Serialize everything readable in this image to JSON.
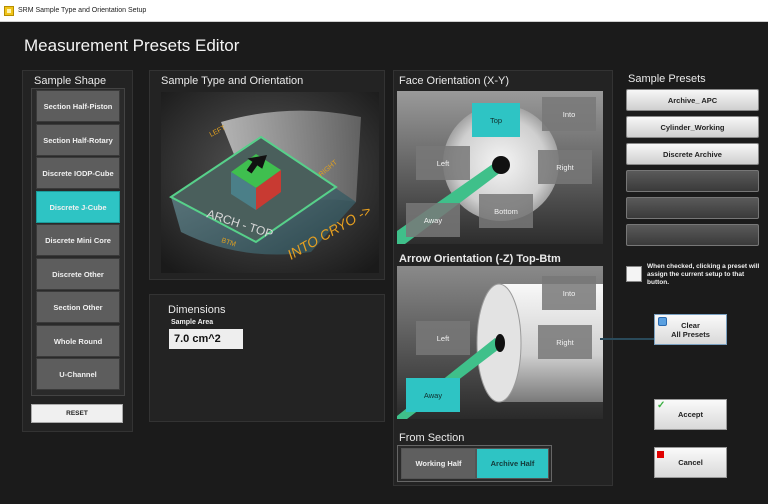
{
  "window": {
    "title": "SRM Sample Type and Orientation Setup"
  },
  "page": {
    "title": "Measurement Presets Editor"
  },
  "sample_shape": {
    "title": "Sample Shape",
    "items": [
      {
        "label": "Section Half-Piston",
        "active": false
      },
      {
        "label": "Section Half-Rotary",
        "active": false
      },
      {
        "label": "Discrete IODP-Cube",
        "active": false
      },
      {
        "label": "Discrete J-Cube",
        "active": true
      },
      {
        "label": "Discrete Mini Core",
        "active": false
      },
      {
        "label": "Discrete Other",
        "active": false
      },
      {
        "label": "Section Other",
        "active": false
      },
      {
        "label": "Whole Round",
        "active": false
      },
      {
        "label": "U-Channel",
        "active": false
      }
    ],
    "reset_label": "RESET"
  },
  "sample_type": {
    "title": "Sample Type and Orientation",
    "image_labels": {
      "left": "LEFT",
      "right": "RIGHT",
      "top": "ARCH - TOP",
      "bottom": "BTM",
      "cryo": "INTO CRYO ->"
    }
  },
  "dimensions": {
    "title": "Dimensions",
    "area_label": "Sample Area",
    "area_value": "7.0 cm^2"
  },
  "face_orientation": {
    "title": "Face Orientation (X-Y)",
    "labels": {
      "top": "Top",
      "into": "Into",
      "left": "Left",
      "right": "Right",
      "away": "Away",
      "bottom": "Bottom"
    },
    "selected": "top"
  },
  "arrow_orientation": {
    "title": "Arrow Orientation (-Z) Top-Btm",
    "labels": {
      "into": "Into",
      "left": "Left",
      "right": "Right",
      "away": "Away"
    },
    "selected": "away"
  },
  "from_section": {
    "title": "From Section",
    "working_label": "Working Half",
    "archive_label": "Archive Half",
    "selected": "archive"
  },
  "presets": {
    "title": "Sample Presets",
    "items": [
      "Archive_ APC",
      "Cylinder_Working",
      "Discrete Archive",
      "",
      "",
      ""
    ],
    "assign_note": "When checked, clicking a preset will assign the current setup to that button.",
    "assign_checked": false
  },
  "actions": {
    "clear_label": "Clear\nAll Presets",
    "accept_label": "Accept",
    "cancel_label": "Cancel"
  },
  "colors": {
    "accent_teal": "#2ec4c4",
    "tile_grey": "#787878",
    "background": "#1b1b1b",
    "cancel_red": "#e00000",
    "accept_green": "#3cb043"
  }
}
